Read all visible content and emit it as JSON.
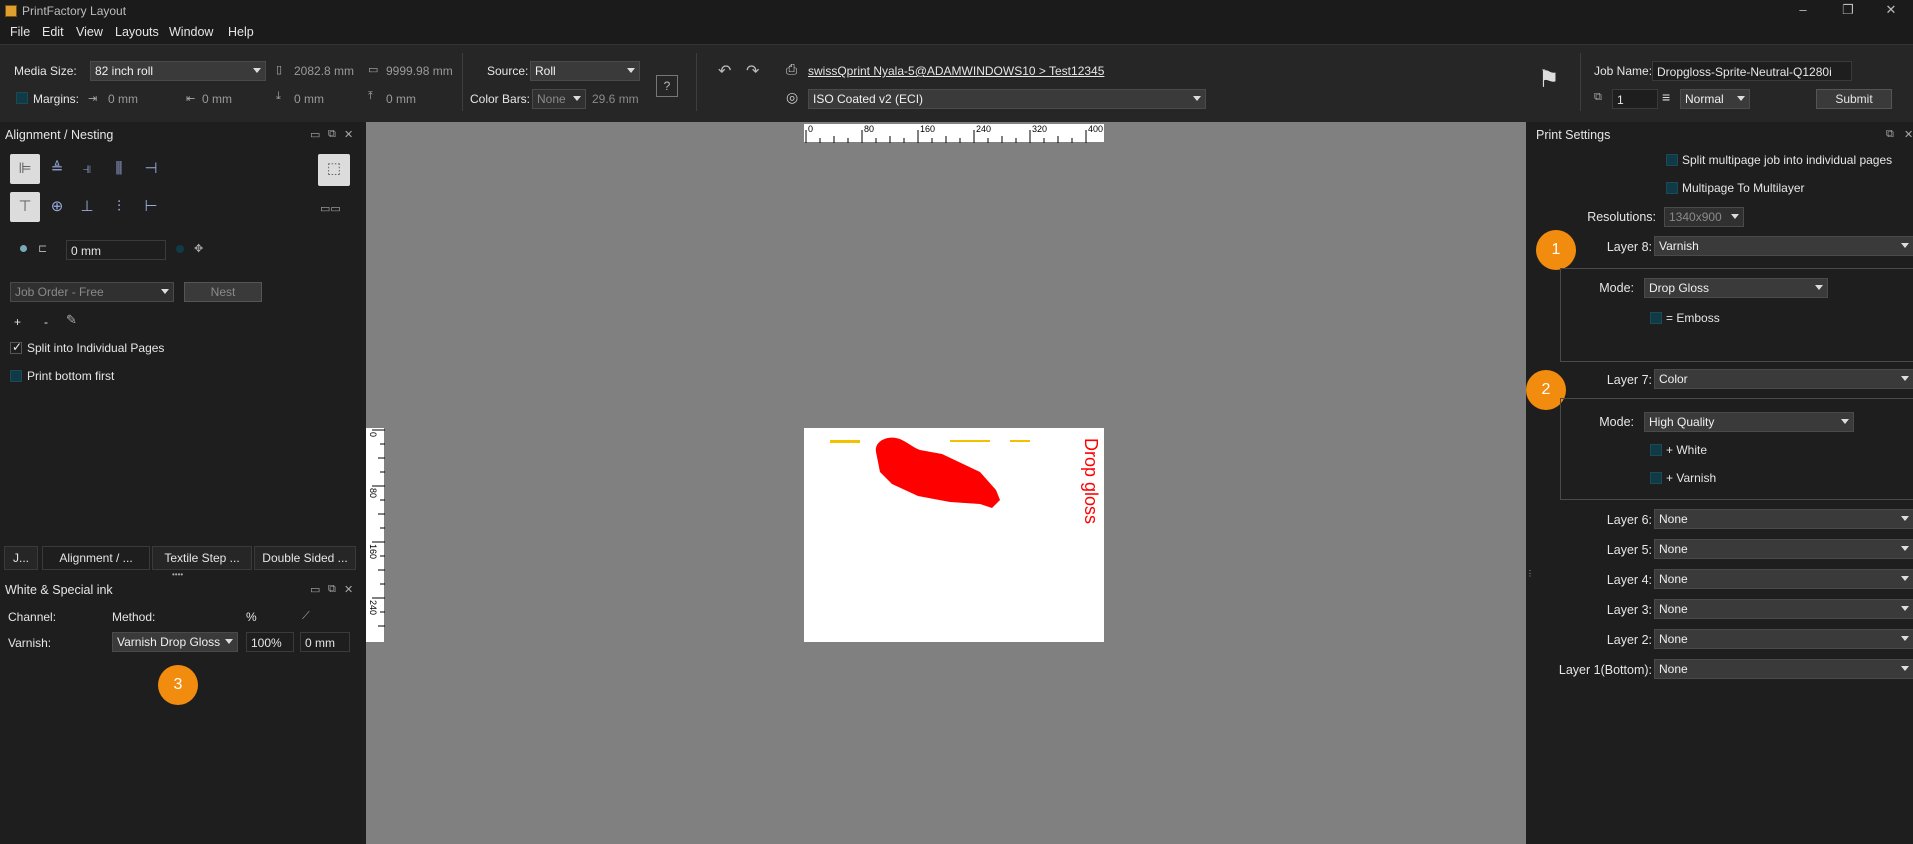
{
  "window": {
    "title": "PrintFactory Layout",
    "controls": [
      "–",
      "❐",
      "✕"
    ]
  },
  "menu": [
    "File",
    "Edit",
    "View",
    "Layouts",
    "Window",
    "Help"
  ],
  "toolbar": {
    "media_size_label": "Media Size:",
    "media_size_value": "82 inch roll",
    "width_value": "2082.8 mm",
    "height_value": "9999.98 mm",
    "margins_label": "Margins:",
    "margin_left": "0 mm",
    "margin_right": "0 mm",
    "margin_bottom": "0 mm",
    "margin_top": "0 mm",
    "source_label": "Source:",
    "source_value": "Roll",
    "color_bars_label": "Color Bars:",
    "color_bars_value": "None",
    "color_bars_size": "29.6 mm",
    "printer_link": "swissQprint Nyala-5@ADAMWINDOWS10 > Test12345",
    "profile_value": "ISO Coated v2 (ECI)",
    "job_name_label": "Job Name:",
    "job_name_value": "Dropgloss-Sprite-Neutral-Q1280i",
    "copies_value": "1",
    "priority_value": "Normal",
    "submit_label": "Submit"
  },
  "alignment_panel": {
    "title": "Alignment / Nesting",
    "spacing_value": "0 mm",
    "job_order_value": "Job Order - Free",
    "nest_label": "Nest",
    "plus": "+",
    "minus": "-",
    "split_label": "Split into Individual Pages",
    "print_bottom_label": "Print bottom first",
    "tabs": [
      "J...",
      "Alignment / ...",
      "Textile Step ...",
      "Double Sided ..."
    ]
  },
  "white_special_panel": {
    "title": "White & Special ink",
    "channel_header": "Channel:",
    "method_header": "Method:",
    "percent_header": "%",
    "row_channel": "Varnish:",
    "row_method": "Varnish Drop Gloss",
    "row_percent": "100%",
    "row_offset": "0 mm"
  },
  "canvas": {
    "ruler_top": [
      "0",
      "80",
      "160",
      "240",
      "320",
      "400"
    ],
    "ruler_left": [
      "0",
      "80",
      "160",
      "240"
    ],
    "artwork_text": "Drop gloss",
    "artwork_color": "#ff0000"
  },
  "print_settings": {
    "title": "Print Settings",
    "split_multipage": "Split multipage job into individual pages",
    "multipage_multilayer": "Multipage To Multilayer",
    "resolutions_label": "Resolutions:",
    "resolutions_value": "1340x900",
    "layer8_label": "Layer 8:",
    "layer8_value": "Varnish",
    "mode_label": "Mode:",
    "layer8_mode": "Drop Gloss",
    "emboss_label": "= Emboss",
    "layer7_label": "Layer 7:",
    "layer7_value": "Color",
    "layer7_mode": "High Quality",
    "white_label": "+ White",
    "varnish_label": "+ Varnish",
    "layer6_label": "Layer 6:",
    "layer5_label": "Layer 5:",
    "layer4_label": "Layer 4:",
    "layer3_label": "Layer 3:",
    "layer2_label": "Layer 2:",
    "layer1_label": "Layer 1(Bottom):",
    "none": "None"
  },
  "badges": [
    "1",
    "2",
    "3"
  ],
  "accent_color": "#f28c0f"
}
